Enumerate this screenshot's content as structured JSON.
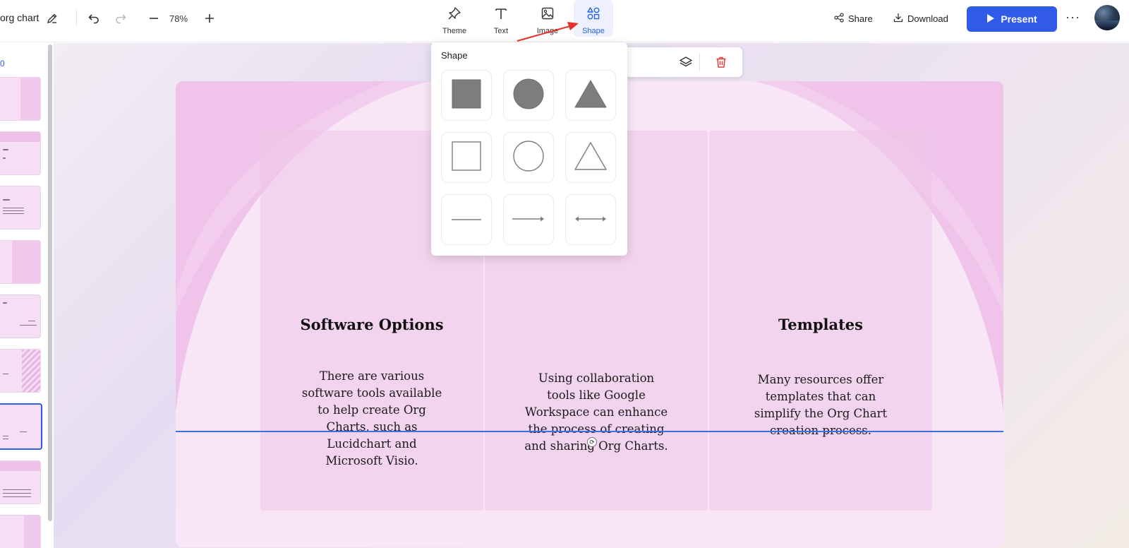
{
  "header": {
    "doc_title": "org chart",
    "zoom": "78%",
    "tools": [
      {
        "label": "Theme",
        "icon": "pin-icon"
      },
      {
        "label": "Text",
        "icon": "text-t-icon"
      },
      {
        "label": "Image",
        "icon": "image-icon"
      },
      {
        "label": "Shape",
        "icon": "shapes-icon",
        "active": true
      }
    ],
    "share_label": "Share",
    "download_label": "Download",
    "present_label": "Present",
    "more_label": "···"
  },
  "sidebar": {
    "slide_number": "0"
  },
  "shape_popup": {
    "title": "Shape",
    "shapes": [
      {
        "name": "filled-square-icon"
      },
      {
        "name": "filled-circle-icon"
      },
      {
        "name": "filled-triangle-icon"
      },
      {
        "name": "outline-square-icon"
      },
      {
        "name": "outline-circle-icon"
      },
      {
        "name": "outline-triangle-icon"
      },
      {
        "name": "line-icon"
      },
      {
        "name": "arrow-line-icon"
      },
      {
        "name": "double-arrow-line-icon"
      }
    ]
  },
  "slide": {
    "columns": [
      {
        "title": "Software Options",
        "body": [
          "There are various",
          "software tools available",
          "to help create Org",
          "Charts, such as",
          "Lucidchart and",
          "Microsoft Visio."
        ]
      },
      {
        "title": "",
        "body": [
          "Using collaboration",
          "tools like Google",
          "Workspace can enhance",
          "the process of creating",
          "and sharing Org Charts."
        ]
      },
      {
        "title": "Templates",
        "body": [
          "Many resources offer",
          "templates that can",
          "simplify the Org Chart",
          "creation process."
        ]
      }
    ]
  },
  "colors": {
    "accent": "#2f5be8",
    "slide_pink": "#edc1e8",
    "delete_red": "#e53935",
    "annotation_red": "#e8302a"
  }
}
